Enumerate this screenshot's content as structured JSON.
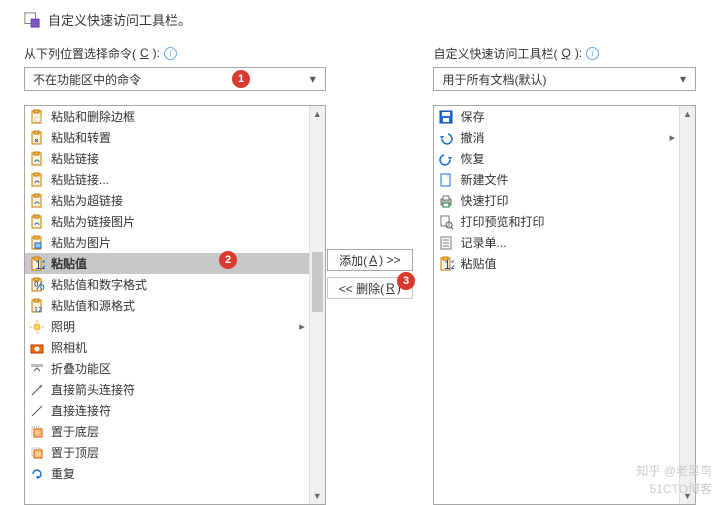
{
  "header": {
    "title": "自定义快速访问工具栏。"
  },
  "labels": {
    "choose_pre": "从下列位置选择命令(",
    "choose_u": "C",
    "choose_post": "):",
    "qat_pre": "自定义快速访问工具栏(",
    "qat_u": "Q",
    "qat_post": "):"
  },
  "dropdowns": {
    "commands": "不在功能区中的命令",
    "target": "用于所有文档(默认)"
  },
  "left_items": [
    {
      "label": "粘贴和删除边框",
      "icon": "paste-noborder-icon"
    },
    {
      "label": "粘贴和转置",
      "icon": "paste-transpose-icon"
    },
    {
      "label": "粘贴链接",
      "icon": "paste-link-icon"
    },
    {
      "label": "粘贴链接...",
      "icon": "paste-link2-icon"
    },
    {
      "label": "粘贴为超链接",
      "icon": "paste-hyperlink-icon"
    },
    {
      "label": "粘贴为链接图片",
      "icon": "paste-linkpic-icon"
    },
    {
      "label": "粘贴为图片",
      "icon": "paste-pic-icon"
    },
    {
      "label": "粘贴值",
      "icon": "paste-values-icon",
      "selected": true
    },
    {
      "label": "粘贴值和数字格式",
      "icon": "paste-valnum-icon"
    },
    {
      "label": "粘贴值和源格式",
      "icon": "paste-valsrc-icon"
    },
    {
      "label": "照明",
      "icon": "lighting-icon",
      "submenu": true
    },
    {
      "label": "照相机",
      "icon": "camera-icon"
    },
    {
      "label": "折叠功能区",
      "icon": "collapse-ribbon-icon"
    },
    {
      "label": "直接箭头连接符",
      "icon": "arrow-connector-icon"
    },
    {
      "label": "直接连接符",
      "icon": "straight-connector-icon"
    },
    {
      "label": "置于底层",
      "icon": "send-back-icon"
    },
    {
      "label": "置于顶层",
      "icon": "bring-front-icon"
    },
    {
      "label": "重复",
      "icon": "repeat-icon"
    }
  ],
  "right_items": [
    {
      "label": "保存",
      "icon": "save-icon",
      "cls": "c-save"
    },
    {
      "label": "撤消",
      "icon": "undo-icon",
      "cls": "c-undo",
      "submenu": true
    },
    {
      "label": "恢复",
      "icon": "redo-icon",
      "cls": "c-redo"
    },
    {
      "label": "新建文件",
      "icon": "new-file-icon",
      "cls": "c-file"
    },
    {
      "label": "快速打印",
      "icon": "quick-print-icon",
      "cls": "c-print"
    },
    {
      "label": "打印预览和打印",
      "icon": "print-preview-icon",
      "cls": "c-preview"
    },
    {
      "label": "记录单...",
      "icon": "form-icon",
      "cls": "c-form"
    },
    {
      "label": "粘贴值",
      "icon": "paste-values-icon",
      "cls": "c-paste"
    }
  ],
  "buttons": {
    "add_pre": "添加(",
    "add_u": "A",
    "add_post": ") >>",
    "remove_pre": "<< 删除(",
    "remove_u": "R",
    "remove_post": ")"
  },
  "badges": {
    "b1": "1",
    "b2": "2",
    "b3": "3"
  },
  "watermark1": "知乎 @老菜鸟",
  "watermark2": "51CTO博客"
}
